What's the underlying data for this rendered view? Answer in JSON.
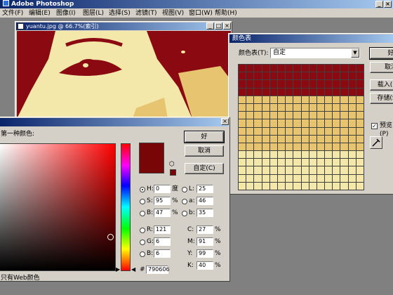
{
  "app": {
    "title": "Adobe Photoshop"
  },
  "menu": [
    "文件(F)",
    "编辑(E)",
    "图像(I)",
    "图层(L)",
    "选择(S)",
    "滤镜(T)",
    "视图(V)",
    "窗口(W)",
    "帮助(H)"
  ],
  "image_window": {
    "title": "yuantu.jpg @ 66.7%(索引)",
    "colors": {
      "dark": "#8b0a12",
      "light": "#f3e7a9",
      "mid": "#e7c46f"
    }
  },
  "color_table": {
    "title": "颜色表",
    "label": "颜色表(T):",
    "value": "自定",
    "buttons": {
      "ok": "好",
      "cancel": "取消",
      "load": "载入(L)...",
      "save": "存储(S)..."
    },
    "preview_label": "预览(P)",
    "preview_checked": true,
    "rows": {
      "dark": 4,
      "mid": 7,
      "light": 5
    },
    "colors": {
      "dark": "#8b0a12",
      "mid": "#e7c46f",
      "light": "#f3e7a9"
    }
  },
  "color_picker": {
    "subtitle": "第一种颜色:",
    "buttons": {
      "ok": "好",
      "cancel": "取消",
      "custom": "自定(C)"
    },
    "new_color": "#790606",
    "web_only_label": "只有Web颜色",
    "H": {
      "label": "H:",
      "value": "0",
      "unit": "度"
    },
    "S": {
      "label": "S:",
      "value": "95",
      "unit": "%"
    },
    "B": {
      "label": "B:",
      "value": "47",
      "unit": "%"
    },
    "R": {
      "label": "R:",
      "value": "121"
    },
    "G": {
      "label": "G:",
      "value": "6"
    },
    "Bb": {
      "label": "B:",
      "value": "6"
    },
    "L": {
      "label": "L:",
      "value": "25"
    },
    "a": {
      "label": "a:",
      "value": "46"
    },
    "b": {
      "label": "b:",
      "value": "35"
    },
    "C": {
      "label": "C:",
      "value": "27",
      "unit": "%"
    },
    "M": {
      "label": "M:",
      "value": "91",
      "unit": "%"
    },
    "Y": {
      "label": "Y:",
      "value": "99",
      "unit": "%"
    },
    "K": {
      "label": "K:",
      "value": "40",
      "unit": "%"
    },
    "hex_label": "#",
    "hex": "790606"
  }
}
